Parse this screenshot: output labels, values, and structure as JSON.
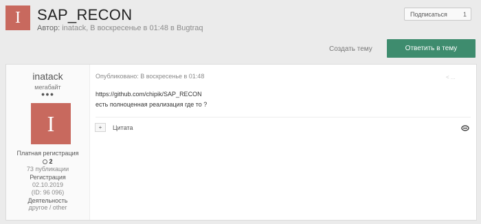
{
  "topic": {
    "avatar_letter": "I",
    "title": "SAP_RECON",
    "meta_prefix": "Автор:",
    "meta_rest": "inatack, В воскресенье в 01:48 в Bugtraq"
  },
  "actions": {
    "follow_label": "Подписаться",
    "follow_count": "1",
    "create_topic_label": "Создать тему",
    "reply_label": "Ответить в тему"
  },
  "post": {
    "author": {
      "name": "inatack",
      "rank": "мегабайт",
      "dots": "●●●",
      "avatar_letter": "I",
      "group": "Платная регистрация",
      "reputation": "2",
      "posts": "73 публикации",
      "reg_label": "Регистрация",
      "reg_date": "02.10.2019",
      "id": "(ID: 96 096)",
      "activity_label": "Деятельность",
      "activity_value": "другое / other"
    },
    "date": "Опубликовано: В воскресенье в 01:48",
    "share_text": "<  ...",
    "body_line1": "https://github.com/chipik/SAP_RECON",
    "body_line2": "есть полноценная реализация где то ?",
    "quote_icon": "+",
    "quote_label": "Цитата",
    "react_icon": "reaction-icon"
  }
}
